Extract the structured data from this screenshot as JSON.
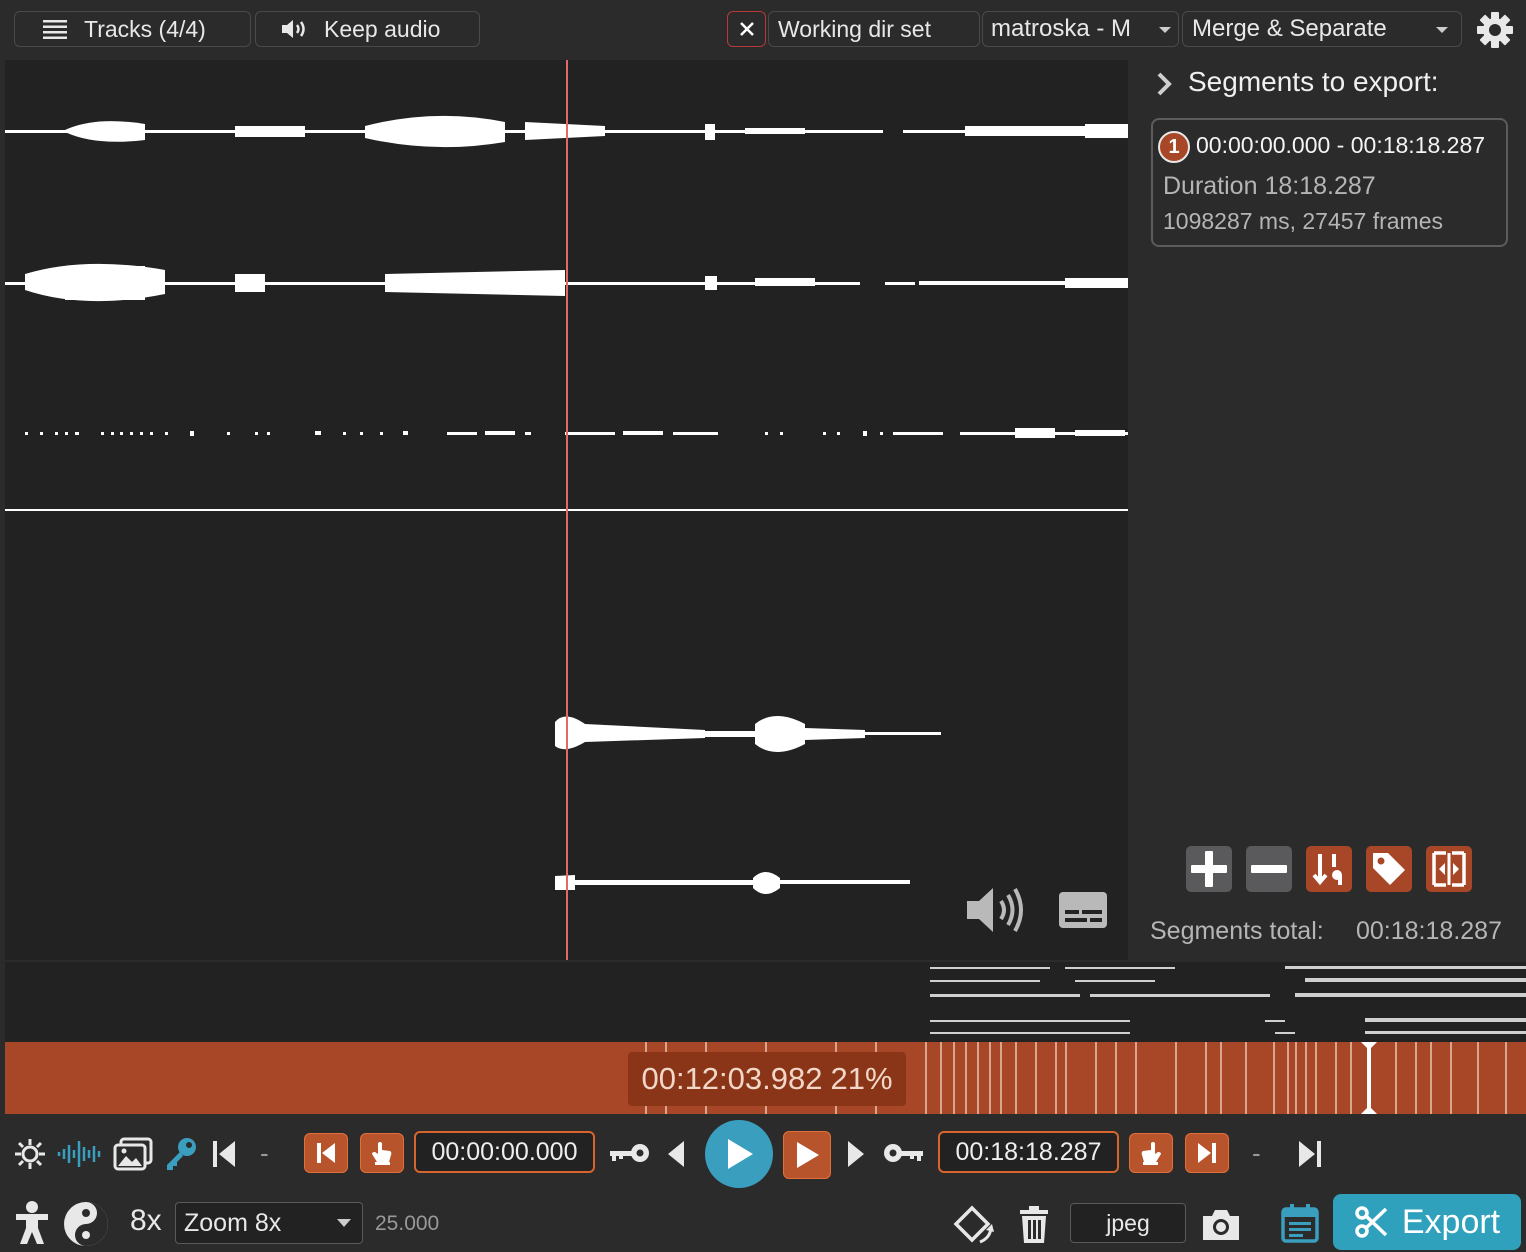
{
  "toolbar": {
    "tracks_label": "Tracks (4/4)",
    "audio_label": "Keep audio",
    "working_dir_label": "Working dir set",
    "format_value": "matroska - M",
    "mode_value": "Merge & Separate"
  },
  "segments_panel": {
    "title": "Segments to export:",
    "segments": [
      {
        "index": "1",
        "range": "00:00:00.000 - 00:18:18.287",
        "duration": "Duration 18:18.287",
        "detail": "1098287 ms, 27457 frames"
      }
    ],
    "total_label": "Segments total:",
    "total_value": "00:18:18.287"
  },
  "timeline": {
    "current_time": "00:12:03.982",
    "zoom_percent": "21%"
  },
  "playback": {
    "separator_left": "-",
    "start_time": "00:00:00.000",
    "end_time": "00:18:18.287",
    "separator_right": "-"
  },
  "bottom": {
    "zoom_factor": "8x",
    "zoom_select": "Zoom 8x",
    "fps": "25.000",
    "capture_format": "jpeg",
    "export_label": "Export"
  },
  "colors": {
    "accent_orange": "#a74727",
    "orange_border": "#d8652e",
    "play_blue": "#3a9fbf",
    "export_teal": "#2fa1bd",
    "playhead": "#e06a6a"
  }
}
